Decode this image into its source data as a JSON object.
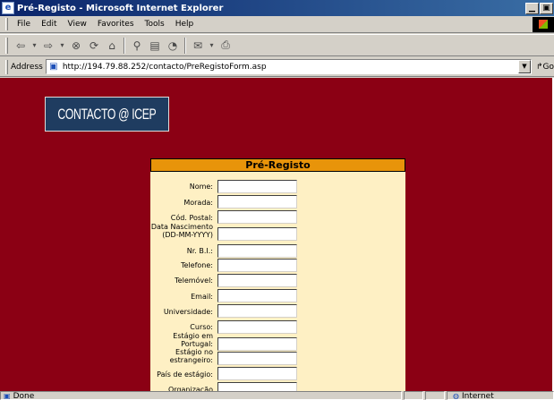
{
  "window": {
    "title": "Pré-Registo - Microsoft Internet Explorer",
    "app_icon": "ie-page-icon",
    "controls": [
      "minimize",
      "maximize"
    ]
  },
  "menubar": {
    "items": [
      {
        "label": "File",
        "accel": "F"
      },
      {
        "label": "Edit",
        "accel": "E"
      },
      {
        "label": "View",
        "accel": "V"
      },
      {
        "label": "Favorites",
        "accel": "a"
      },
      {
        "label": "Tools",
        "accel": "T"
      },
      {
        "label": "Help",
        "accel": "H"
      }
    ]
  },
  "toolbar": {
    "buttons": [
      "back-icon",
      "forward-icon",
      "stop-icon",
      "refresh-icon",
      "home-icon",
      "search-icon",
      "favorites-icon",
      "history-icon",
      "mail-icon",
      "print-icon"
    ]
  },
  "address": {
    "label": "Address",
    "url": "http://194.79.88.252/contacto/PreRegistoForm.asp",
    "go_label": "Go"
  },
  "page": {
    "logo_text": "CONTACTO @ ICEP",
    "form_title": "Pré-Registo",
    "fields": [
      {
        "label": "Nome:",
        "value": ""
      },
      {
        "label": "Morada:",
        "value": ""
      },
      {
        "label": "Cód. Postal:",
        "value": ""
      },
      {
        "label": "Data Nascimento (DD-MM-YYYY)",
        "value": ""
      },
      {
        "label": "Nr. B.I.:",
        "value": ""
      },
      {
        "label": "Telefone:",
        "value": ""
      },
      {
        "label": "Telemóvel:",
        "value": ""
      },
      {
        "label": "Email:",
        "value": ""
      },
      {
        "label": "Universidade:",
        "value": ""
      },
      {
        "label": "Curso:",
        "value": ""
      },
      {
        "label": "Estágio em Portugal:",
        "value": ""
      },
      {
        "label": "Estágio no estrangeiro:",
        "value": ""
      },
      {
        "label": "País de estágio:",
        "value": ""
      },
      {
        "label": "Organização Actual",
        "value": ""
      }
    ]
  },
  "status": {
    "text": "Done",
    "zone": "Internet"
  },
  "colors": {
    "page_background": "#8b0014",
    "form_header": "#e8940a",
    "form_body": "#fef0c4",
    "logo_background": "#1f3c60"
  }
}
